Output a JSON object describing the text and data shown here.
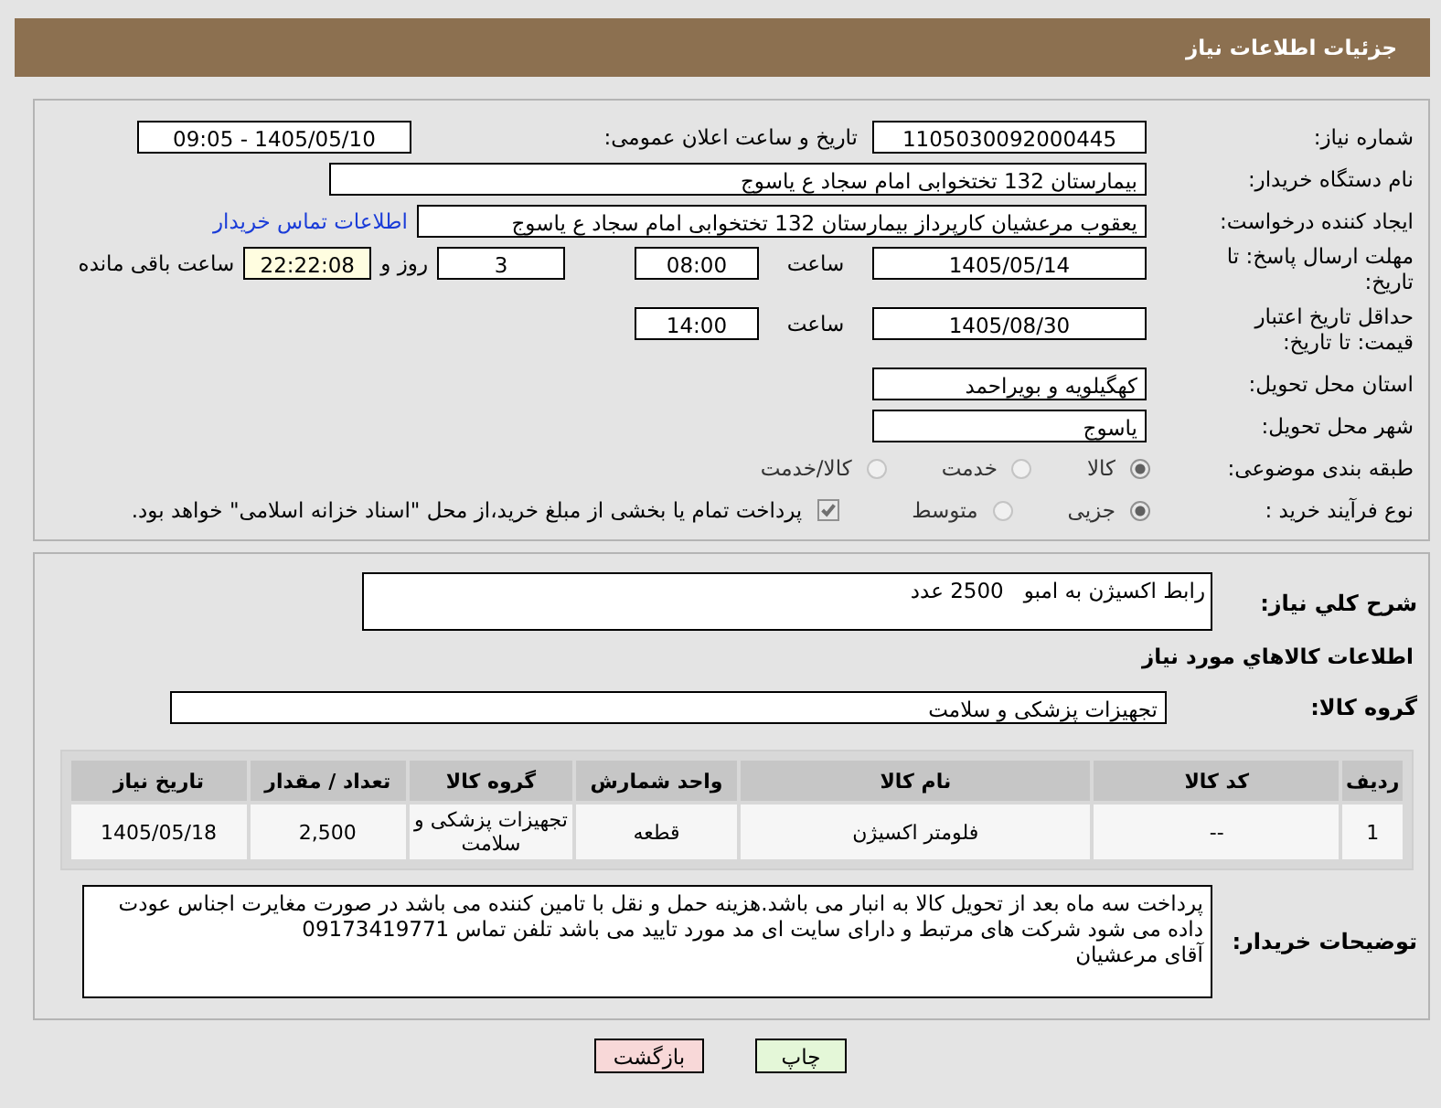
{
  "header": {
    "title": "جزئیات اطلاعات نیاز"
  },
  "fields": {
    "need_number": {
      "label": "شماره نیاز:",
      "value": "1105030092000445"
    },
    "announce": {
      "label": "تاریخ و ساعت اعلان عمومی:",
      "value": "1405/05/10 - 09:05"
    },
    "buyer_org": {
      "label": "نام دستگاه خریدار:",
      "value": "بیمارستان 132 تختخوابی امام سجاد  ع  یاسوج"
    },
    "requester": {
      "label": "ایجاد کننده درخواست:",
      "value": "یعقوب مرعشیان کارپرداز بیمارستان 132 تختخوابی امام سجاد  ع  یاسوج",
      "link": "اطلاعات تماس خریدار"
    },
    "deadline": {
      "label": "مهلت ارسال پاسخ: تا تاریخ:",
      "date": "1405/05/14",
      "time_label": "ساعت",
      "time": "08:00",
      "days": "3",
      "days_label": "روز و",
      "remaining": "22:22:08",
      "remaining_label": "ساعت باقی مانده"
    },
    "price_validity": {
      "label": "حداقل تاریخ اعتبار قیمت: تا تاریخ:",
      "date": "1405/08/30",
      "time_label": "ساعت",
      "time": "14:00"
    },
    "province": {
      "label": "استان محل تحویل:",
      "value": "کهگیلویه و بویراحمد"
    },
    "city": {
      "label": "شهر محل تحویل:",
      "value": "یاسوج"
    }
  },
  "category": {
    "label": "طبقه بندی موضوعی:",
    "options": [
      {
        "label": "کالا",
        "selected": true
      },
      {
        "label": "خدمت",
        "selected": false
      },
      {
        "label": "کالا/خدمت",
        "selected": false
      }
    ]
  },
  "process": {
    "label": "نوع فرآیند خرید :",
    "options": [
      {
        "label": "جزیی",
        "selected": true
      },
      {
        "label": "متوسط",
        "selected": false
      }
    ],
    "treasury": {
      "checked": true,
      "label": "پرداخت تمام یا بخشی از مبلغ خرید،از محل \"اسناد خزانه اسلامی\" خواهد بود."
    }
  },
  "summary": {
    "label": "شرح کلي نياز:",
    "value": "رابط اکسیژن به امبو   2500 عدد"
  },
  "goods_heading": "اطلاعات کالاهاي مورد نياز",
  "goods_group": {
    "label": "گروه کالا:",
    "value": "تجهیزات پزشکی و سلامت"
  },
  "table": {
    "columns": [
      "ردیف",
      "کد کالا",
      "نام کالا",
      "واحد شمارش",
      "گروه کالا",
      "تعداد / مقدار",
      "تاریخ نیاز"
    ],
    "rows": [
      [
        "1",
        "--",
        "فلومتر اکسیژن",
        "قطعه",
        "تجهیزات پزشکی و سلامت",
        "2,500",
        "1405/05/18"
      ]
    ]
  },
  "buyer_notes": {
    "label": "توضیحات خریدار:",
    "value": "پرداخت سه ماه بعد از تحویل کالا به انبار می باشد.هزینه حمل و نقل با تامین کننده می باشد در صورت مغایرت اجناس عودت داده می شود شرکت های مرتبط و دارای سایت ای مد مورد تایید می باشد تلفن تماس 09173419771\nآقای مرعشیان"
  },
  "buttons": [
    {
      "kind": "print",
      "label": "چاپ"
    },
    {
      "kind": "back",
      "label": "بازگشت"
    }
  ]
}
